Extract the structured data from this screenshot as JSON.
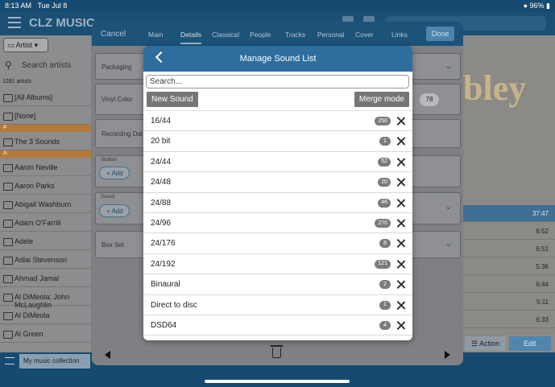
{
  "status": {
    "time": "8:13 AM",
    "date": "Tue Jul 8",
    "battery": "96%"
  },
  "app": {
    "title": "CLZ MUSIC"
  },
  "left": {
    "filter_label": "Artist",
    "search_placeholder": "Search artists",
    "count": "1281 artists",
    "sections": {
      "hash": "#",
      "a": "A"
    },
    "rows_top": [
      "[All Albums]",
      "[None]"
    ],
    "row_hash": "The 3 Sounds",
    "rows_a": [
      "Aaron Neville",
      "Aaron Parks",
      "Abigail Washburn",
      "Adam O'Farrill",
      "Adele",
      "Adlai Stevenson",
      "Ahmad Jamal",
      "Al DiMeola; John McLaughlin",
      "Al DiMeola",
      "Al Green"
    ]
  },
  "right": {
    "big_text": "bley",
    "tracks": [
      "37:47",
      "6:52",
      "6:51",
      "5:36",
      "6:44",
      "5:11",
      "6:33"
    ],
    "action_label": "Action",
    "edit_label": "Edit"
  },
  "bottom": {
    "collection": "My music collection"
  },
  "sheet": {
    "cancel": "Cancel",
    "done": "Done",
    "tabs": [
      "Main",
      "Details",
      "Classical",
      "People",
      "Tracks",
      "Personal",
      "Cover",
      "Links"
    ],
    "active_tab": "Details",
    "fields": {
      "packaging": "Packaging",
      "vinyl_color": "Vinyl Color",
      "vinyl_count": "78",
      "recording_date": "Recording Dat",
      "studios": "Studios",
      "sound": "Sound",
      "add": "Add",
      "box_set": "Box Set"
    }
  },
  "modal": {
    "title": "Manage Sound List",
    "search_placeholder": "Search...",
    "new_button": "New Sound",
    "merge_button": "Merge mode",
    "items": [
      {
        "name": "16/44",
        "count": "250"
      },
      {
        "name": "20 bit",
        "count": "1"
      },
      {
        "name": "24/44",
        "count": "52"
      },
      {
        "name": "24/48",
        "count": "20"
      },
      {
        "name": "24/88",
        "count": "46"
      },
      {
        "name": "24/96",
        "count": "270"
      },
      {
        "name": "24/176",
        "count": "8"
      },
      {
        "name": "24/192",
        "count": "121"
      },
      {
        "name": "Binaural",
        "count": "2"
      },
      {
        "name": "Direct to disc",
        "count": "1"
      },
      {
        "name": "DSD64",
        "count": "4"
      }
    ]
  },
  "colors": {
    "header": "#2e6d9c",
    "badge": "#7b7b7b",
    "button": "#767676"
  }
}
